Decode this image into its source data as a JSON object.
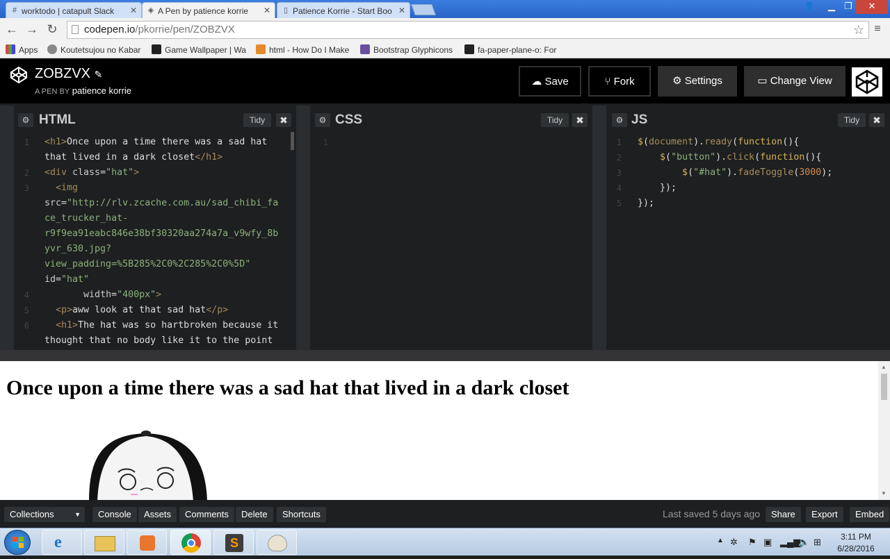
{
  "browser": {
    "tabs": [
      {
        "label": "worktodo | catapult Slack",
        "icon": "hash-icon"
      },
      {
        "label": "A Pen by patience korrie",
        "icon": "codepen-icon"
      },
      {
        "label": "Patience Korrie - Start Boo",
        "icon": "page-icon"
      }
    ],
    "url_domain": "codepen.io",
    "url_path": "/pkorrie/pen/ZOBZVX",
    "bookmarks": [
      {
        "label": "Apps",
        "icon": "apps-grid-icon",
        "color": "#d44"
      },
      {
        "label": "Koutetsujou no Kabar",
        "icon": "globe-icon",
        "color": "#888"
      },
      {
        "label": "Game Wallpaper | Wa",
        "icon": "flag-icon",
        "color": "#222"
      },
      {
        "label": "html - How Do I Make",
        "icon": "stackoverflow-icon",
        "color": "#e58a2c"
      },
      {
        "label": "Bootstrap Glyphicons",
        "icon": "page-icon",
        "color": "#6a4fa0"
      },
      {
        "label": "fa-paper-plane-o: For",
        "icon": "flag-icon",
        "color": "#222"
      }
    ]
  },
  "codepen": {
    "pen_title": "ZOBZVX",
    "byline_prefix": "A PEN BY",
    "author": "patience korrie",
    "buttons": {
      "save": "Save",
      "fork": "Fork",
      "settings": "Settings",
      "change_view": "Change View"
    }
  },
  "editors": {
    "html": {
      "title": "HTML",
      "tidy": "Tidy",
      "line_numbers": [
        "1",
        "2",
        "3",
        "4",
        "5",
        "6"
      ]
    },
    "css": {
      "title": "CSS",
      "tidy": "Tidy",
      "line_numbers": [
        "1"
      ]
    },
    "js": {
      "title": "JS",
      "tidy": "Tidy",
      "line_numbers": [
        "1",
        "2",
        "3",
        "4",
        "5"
      ]
    }
  },
  "preview": {
    "heading": "Once upon a time there was a sad hat that lived in a dark closet"
  },
  "bottom_bar": {
    "collections": "Collections",
    "console": "Console",
    "assets": "Assets",
    "comments": "Comments",
    "delete": "Delete",
    "shortcuts": "Shortcuts",
    "last_saved": "Last saved 5 days ago",
    "share": "Share",
    "export": "Export",
    "embed": "Embed"
  },
  "taskbar": {
    "time": "3:11 PM",
    "date": "6/28/2016"
  }
}
